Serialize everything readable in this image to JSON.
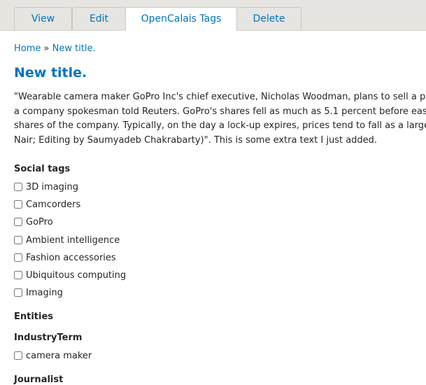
{
  "tabs": [
    {
      "label": "View"
    },
    {
      "label": "Edit"
    },
    {
      "label": "OpenCalais Tags"
    },
    {
      "label": "Delete"
    }
  ],
  "breadcrumb": {
    "home": "Home",
    "separator": "»",
    "current": "New title."
  },
  "page_title": "New title.",
  "body_lines": [
    "\"Wearable camera maker GoPro Inc's chief executive, Nicholas Woodman, plans to sell a po",
    "a company spokesman told Reuters. GoPro's shares fell as much as 5.1 percent before eas",
    "shares of the company. Typically, on the day a lock-up expires, prices tend to fall as a large",
    "Nair; Editing by Saumyadeb Chakrabarty)\". This is some extra text I just added."
  ],
  "social_tags": {
    "heading": "Social tags",
    "items": [
      "3D imaging",
      "Camcorders",
      "GoPro",
      "Ambient intelligence",
      "Fashion accessories",
      "Ubiquitous computing",
      "Imaging"
    ]
  },
  "entities": {
    "heading": "Entities",
    "industry_term": {
      "heading": "IndustryTerm",
      "items": [
        "camera maker"
      ]
    },
    "journalist": {
      "heading": "Journalist"
    }
  },
  "colors": {
    "link": "#0074bd",
    "tabbar_bg": "#e6e5e1",
    "text": "#232629"
  }
}
